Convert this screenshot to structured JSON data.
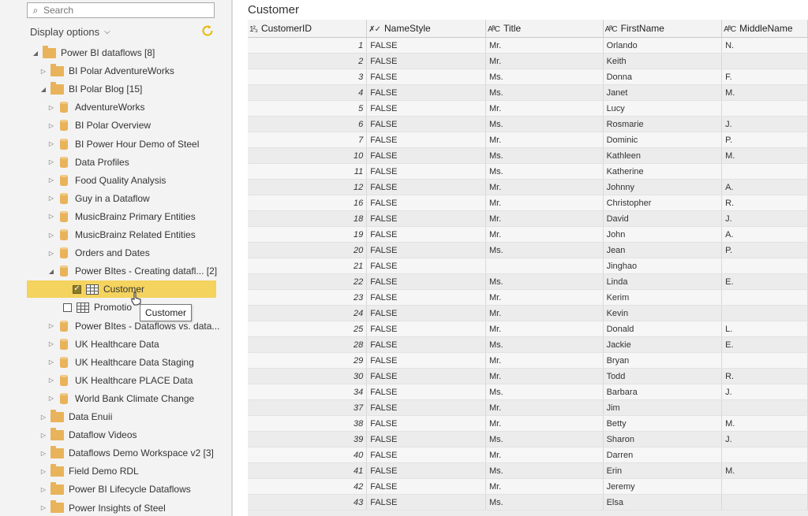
{
  "search": {
    "placeholder": "Search"
  },
  "display_options": {
    "label": "Display options"
  },
  "tree": [
    {
      "label": "Power BI dataflows  [8]",
      "kind": "folder",
      "indent": 0,
      "expanded": true
    },
    {
      "label": "BI Polar AdventureWorks",
      "kind": "folder",
      "indent": 1,
      "expanded": false
    },
    {
      "label": "BI Polar Blog  [15]",
      "kind": "folder",
      "indent": 1,
      "expanded": true
    },
    {
      "label": "AdventureWorks",
      "kind": "db",
      "indent": 2,
      "expanded": false
    },
    {
      "label": "BI Polar Overview",
      "kind": "db",
      "indent": 2,
      "expanded": false
    },
    {
      "label": "BI Power Hour Demo of Steel",
      "kind": "db",
      "indent": 2,
      "expanded": false
    },
    {
      "label": "Data Profiles",
      "kind": "db",
      "indent": 2,
      "expanded": false
    },
    {
      "label": "Food Quality Analysis",
      "kind": "db",
      "indent": 2,
      "expanded": false
    },
    {
      "label": "Guy in a Dataflow",
      "kind": "db",
      "indent": 2,
      "expanded": false
    },
    {
      "label": "MusicBrainz Primary Entities",
      "kind": "db",
      "indent": 2,
      "expanded": false
    },
    {
      "label": "MusicBrainz Related Entities",
      "kind": "db",
      "indent": 2,
      "expanded": false
    },
    {
      "label": "Orders and Dates",
      "kind": "db",
      "indent": 2,
      "expanded": false
    },
    {
      "label": "Power BItes - Creating datafl...  [2]",
      "kind": "db",
      "indent": 2,
      "expanded": true
    },
    {
      "label": "Customer",
      "kind": "table",
      "indent": 3,
      "checked": true,
      "selected": true
    },
    {
      "label": "Promotio",
      "kind": "table",
      "indent": 3,
      "checked": false
    },
    {
      "label": "Power BItes - Dataflows vs. data...",
      "kind": "db",
      "indent": 2,
      "expanded": false
    },
    {
      "label": "UK Healthcare Data",
      "kind": "db",
      "indent": 2,
      "expanded": false
    },
    {
      "label": "UK Healthcare Data Staging",
      "kind": "db",
      "indent": 2,
      "expanded": false
    },
    {
      "label": "UK Healthcare PLACE Data",
      "kind": "db",
      "indent": 2,
      "expanded": false
    },
    {
      "label": "World Bank Climate Change",
      "kind": "db",
      "indent": 2,
      "expanded": false
    },
    {
      "label": "Data Enuii",
      "kind": "folder",
      "indent": 1,
      "expanded": false
    },
    {
      "label": "Dataflow Videos",
      "kind": "folder",
      "indent": 1,
      "expanded": false
    },
    {
      "label": "Dataflows Demo Workspace v2  [3]",
      "kind": "folder",
      "indent": 1,
      "expanded": false
    },
    {
      "label": "Field Demo RDL",
      "kind": "folder",
      "indent": 1,
      "expanded": false
    },
    {
      "label": "Power BI Lifecycle Dataflows",
      "kind": "folder",
      "indent": 1,
      "expanded": false
    },
    {
      "label": "Power Insights of Steel",
      "kind": "folder",
      "indent": 1,
      "expanded": false
    }
  ],
  "tooltip": "Customer",
  "preview": {
    "title": "Customer",
    "columns": [
      {
        "type": "1²₃",
        "name": "CustomerID"
      },
      {
        "type": "✗✓",
        "name": "NameStyle"
      },
      {
        "type": "AᴮC",
        "name": "Title"
      },
      {
        "type": "AᴮC",
        "name": "FirstName"
      },
      {
        "type": "AᴮC",
        "name": "MiddleName"
      }
    ],
    "rows": [
      [
        "1",
        "FALSE",
        "Mr.",
        "Orlando",
        "N."
      ],
      [
        "2",
        "FALSE",
        "Mr.",
        "Keith",
        ""
      ],
      [
        "3",
        "FALSE",
        "Ms.",
        "Donna",
        "F."
      ],
      [
        "4",
        "FALSE",
        "Ms.",
        "Janet",
        "M."
      ],
      [
        "5",
        "FALSE",
        "Mr.",
        "Lucy",
        ""
      ],
      [
        "6",
        "FALSE",
        "Ms.",
        "Rosmarie",
        "J."
      ],
      [
        "7",
        "FALSE",
        "Mr.",
        "Dominic",
        "P."
      ],
      [
        "10",
        "FALSE",
        "Ms.",
        "Kathleen",
        "M."
      ],
      [
        "11",
        "FALSE",
        "Ms.",
        "Katherine",
        ""
      ],
      [
        "12",
        "FALSE",
        "Mr.",
        "Johnny",
        "A."
      ],
      [
        "16",
        "FALSE",
        "Mr.",
        "Christopher",
        "R."
      ],
      [
        "18",
        "FALSE",
        "Mr.",
        "David",
        "J."
      ],
      [
        "19",
        "FALSE",
        "Mr.",
        "John",
        "A."
      ],
      [
        "20",
        "FALSE",
        "Ms.",
        "Jean",
        "P."
      ],
      [
        "21",
        "FALSE",
        "",
        "Jinghao",
        ""
      ],
      [
        "22",
        "FALSE",
        "Ms.",
        "Linda",
        "E."
      ],
      [
        "23",
        "FALSE",
        "Mr.",
        "Kerim",
        ""
      ],
      [
        "24",
        "FALSE",
        "Mr.",
        "Kevin",
        ""
      ],
      [
        "25",
        "FALSE",
        "Mr.",
        "Donald",
        "L."
      ],
      [
        "28",
        "FALSE",
        "Ms.",
        "Jackie",
        "E."
      ],
      [
        "29",
        "FALSE",
        "Mr.",
        "Bryan",
        ""
      ],
      [
        "30",
        "FALSE",
        "Mr.",
        "Todd",
        "R."
      ],
      [
        "34",
        "FALSE",
        "Ms.",
        "Barbara",
        "J."
      ],
      [
        "37",
        "FALSE",
        "Mr.",
        "Jim",
        ""
      ],
      [
        "38",
        "FALSE",
        "Mr.",
        "Betty",
        "M."
      ],
      [
        "39",
        "FALSE",
        "Ms.",
        "Sharon",
        "J."
      ],
      [
        "40",
        "FALSE",
        "Mr.",
        "Darren",
        ""
      ],
      [
        "41",
        "FALSE",
        "Ms.",
        "Erin",
        "M."
      ],
      [
        "42",
        "FALSE",
        "Mr.",
        "Jeremy",
        ""
      ],
      [
        "43",
        "FALSE",
        "Ms.",
        "Elsa",
        ""
      ]
    ]
  },
  "colors": {
    "selection": "#f4d35e",
    "folder": "#e8b35a",
    "refresh": "#e8b800"
  }
}
